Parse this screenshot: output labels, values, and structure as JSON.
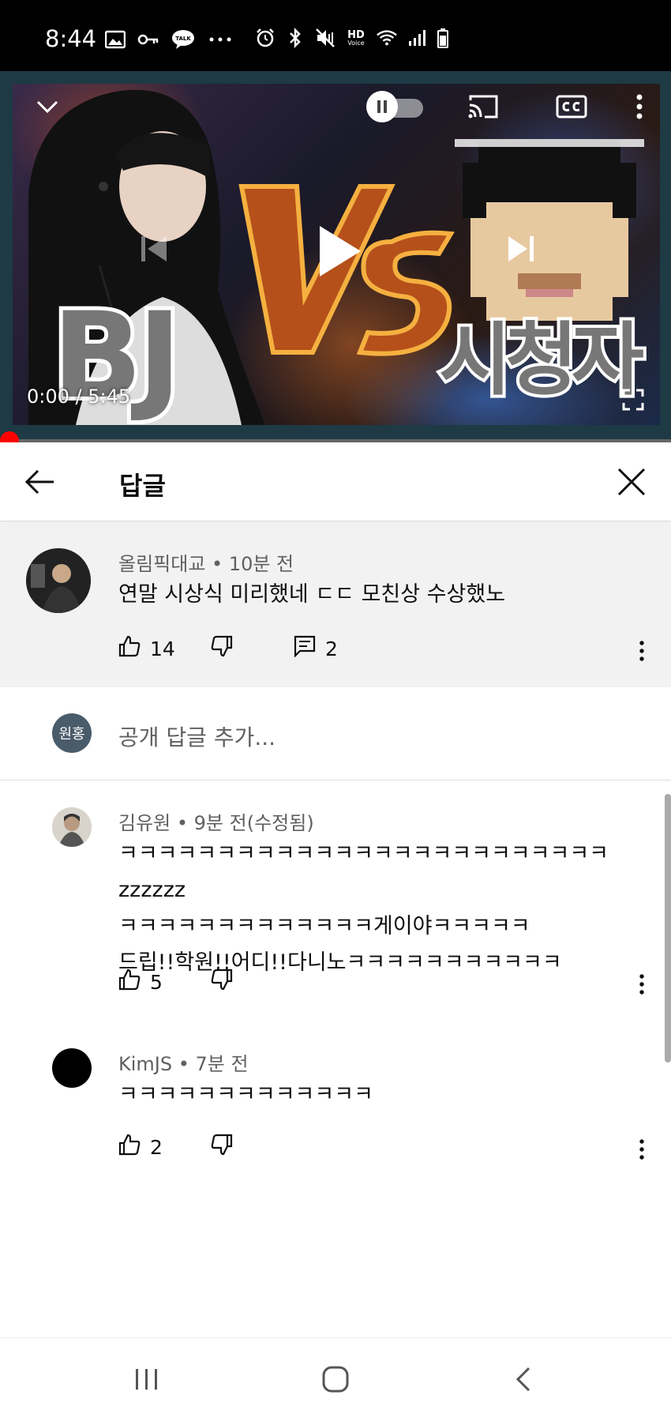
{
  "status_bar": {
    "time": "8:44",
    "icons": [
      "gallery-icon",
      "key-icon",
      "kakaotalk-icon",
      "more-dots-icon",
      "alarm-icon",
      "bluetooth-icon",
      "mute-icon",
      "hd-voice-icon",
      "wifi-icon",
      "signal-icon",
      "battery-icon"
    ],
    "talk_label": "TALK",
    "hd_label": "HD",
    "voice_label": "Voice"
  },
  "player": {
    "current_time": "0:00 / 5:45",
    "thumbnail_text_left": "BJ",
    "thumbnail_text_right": "시청자",
    "progress": 0
  },
  "replies": {
    "title": "답글"
  },
  "parent_comment": {
    "author": "올림픽대교 • 10분 전",
    "text": "연말 시상식 미리했네 ㄷㄷ 모친상 수상했노",
    "likes": "14",
    "replies": "2"
  },
  "add_reply": {
    "avatar_initials": "원홍",
    "placeholder": "공개 답글 추가..."
  },
  "comments": [
    {
      "author": "김유원 • 9분 전(수정됨)",
      "lines": [
        "ㅋㅋㅋㅋㅋㅋㅋㅋㅋㅋㅋㅋㅋㅋㅋㅋㅋㅋㅋㅋㅋㅋㅋㅋㅋzzzzzz",
        "ㅋㅋㅋㅋㅋㅋㅋㅋㅋㅋㅋㅋㅋ게이야ㅋㅋㅋㅋㅋ",
        "드립!!학원!!어디!!다니노ㅋㅋㅋㅋㅋㅋㅋㅋㅋㅋㅋ"
      ],
      "likes": "5"
    },
    {
      "author": "KimJS • 7분 전",
      "lines": [
        "ㅋㅋㅋㅋㅋㅋㅋㅋㅋㅋㅋㅋㅋ"
      ],
      "likes": "2"
    }
  ],
  "colors": {
    "progress": "#ff0000",
    "parent_bg": "#f2f2f2",
    "self_avatar": "#4a5b6a"
  }
}
